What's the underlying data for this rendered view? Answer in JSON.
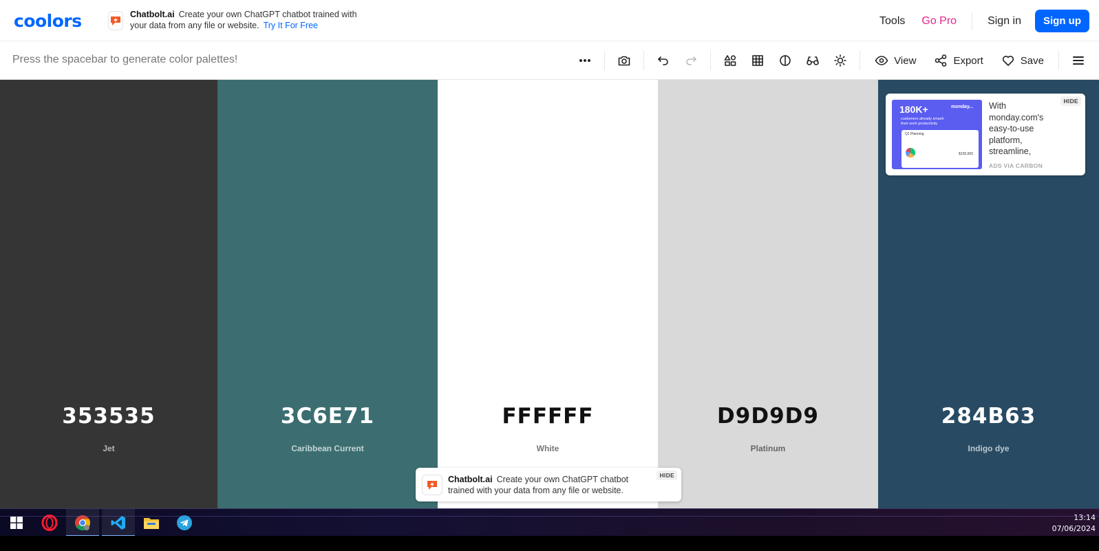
{
  "app": {
    "logo": "coolors",
    "sponsor": {
      "name": "Chatbolt.ai",
      "text": "Create your own ChatGPT chatbot trained with your data from any file or website.",
      "cta": "Try It For Free"
    },
    "nav": {
      "tools": "Tools",
      "go_pro": "Go Pro",
      "sign_in": "Sign in",
      "sign_up": "Sign up"
    }
  },
  "toolbar": {
    "hint": "Press the spacebar to generate color palettes!",
    "icons": [
      "more-icon",
      "camera-icon",
      "undo-icon",
      "redo-icon",
      "shapes-icon",
      "grid-icon",
      "contrast-icon",
      "glasses-icon",
      "sun-icon"
    ],
    "view_label": "View",
    "export_label": "Export",
    "save_label": "Save"
  },
  "palette": [
    {
      "hex": "353535",
      "name": "Jet",
      "color": "#353535",
      "text_color": "#ffffff",
      "name_color": "#b8b8b8"
    },
    {
      "hex": "3C6E71",
      "name": "Caribbean Current",
      "color": "#3C6E71",
      "text_color": "#ffffff",
      "name_color": "#c6d5d6"
    },
    {
      "hex": "FFFFFF",
      "name": "White",
      "color": "#FFFFFF",
      "text_color": "#111111",
      "name_color": "#777777"
    },
    {
      "hex": "D9D9D9",
      "name": "Platinum",
      "color": "#D9D9D9",
      "text_color": "#111111",
      "name_color": "#666666"
    },
    {
      "hex": "284B63",
      "name": "Indigo dye",
      "color": "#284B63",
      "text_color": "#ffffff",
      "name_color": "#bcc8d0"
    }
  ],
  "carbon_ad": {
    "image_big": "180K+",
    "image_small": "customers already smash their work productivity",
    "image_brand": "monday...",
    "image_card_title": "Q1 Planning",
    "image_card_value": "$155,000",
    "text": "With monday.com's easy-to-use platform, streamline,",
    "via": "ADS VIA CARBON",
    "hide": "HIDE"
  },
  "bottom_banner": {
    "name": "Chatbolt.ai",
    "text": "Create your own ChatGPT chatbot trained with your data from any file or website.",
    "hide": "HIDE"
  },
  "taskbar": {
    "apps": [
      "windows-start-icon",
      "opera-icon",
      "chrome-icon",
      "vscode-icon",
      "file-explorer-icon",
      "telegram-icon"
    ],
    "time": "13:14",
    "date": "07/06/2024"
  }
}
